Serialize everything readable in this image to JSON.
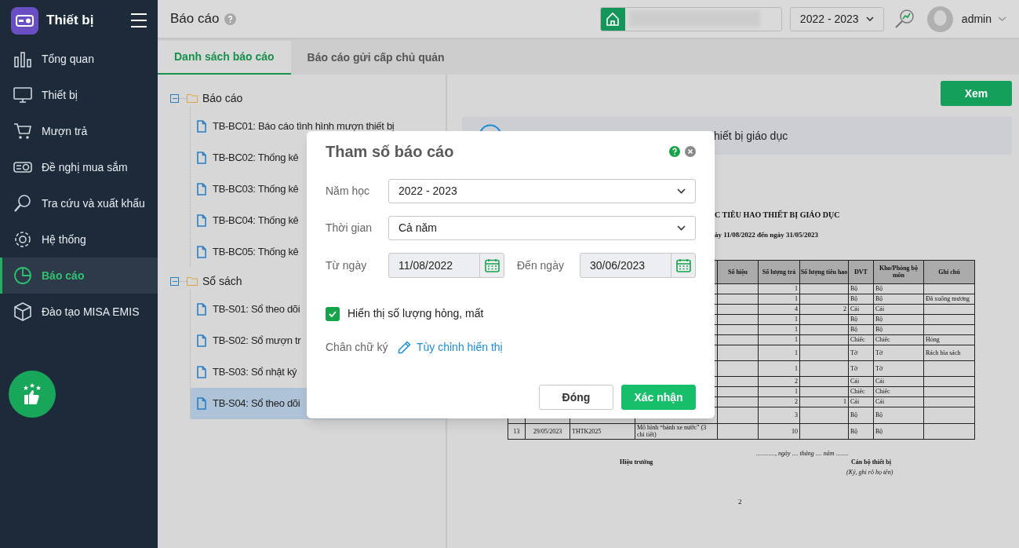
{
  "sidebar": {
    "app_title": "Thiết bị",
    "items": [
      {
        "label": "Tổng quan",
        "selected": false
      },
      {
        "label": "Thiết bị",
        "selected": false
      },
      {
        "label": "Mượn trả",
        "selected": false
      },
      {
        "label": "Đề nghị mua sắm",
        "selected": false
      },
      {
        "label": "Tra cứu và xuất khẩu",
        "selected": false
      },
      {
        "label": "Hệ thống",
        "selected": false
      },
      {
        "label": "Báo cáo",
        "selected": true
      },
      {
        "label": "Đào tạo MISA EMIS",
        "selected": false
      }
    ]
  },
  "header": {
    "title": "Báo cáo",
    "year": "2022 - 2023",
    "user": "admin"
  },
  "tabs": [
    {
      "label": "Danh sách báo cáo",
      "selected": true
    },
    {
      "label": "Báo cáo gửi cấp chủ quản",
      "selected": false
    }
  ],
  "tree": [
    {
      "label": "Báo cáo",
      "expanded": true,
      "children": [
        {
          "label": "TB-BC01: Báo cáo tình hình mượn thiết bị",
          "selected": false
        },
        {
          "label": "TB-BC02: Thống kê",
          "selected": false
        },
        {
          "label": "TB-BC03: Thống kê",
          "selected": false
        },
        {
          "label": "TB-BC04: Thống kê",
          "selected": false
        },
        {
          "label": "TB-BC05: Thống kê",
          "selected": false
        }
      ]
    },
    {
      "label": "Sổ sách",
      "expanded": true,
      "children": [
        {
          "label": "TB-S01: Sổ theo dõi",
          "selected": false
        },
        {
          "label": "TB-S02: Sổ mượn tr",
          "selected": false
        },
        {
          "label": "TB-S03: Sổ nhật ký",
          "selected": false
        },
        {
          "label": "TB-S04: Sổ theo dõi",
          "selected": true
        }
      ]
    }
  ],
  "view_button": "Xem",
  "info_banner": "hiết bị giáo dục",
  "report": {
    "title": "C TIÊU HAO THIẾT BỊ GIÁO DỤC",
    "subtitle": "ày 11/08/2022 đến ngày 31/05/2023",
    "columns": [
      "",
      "",
      "",
      "",
      "Số hiệu",
      "Số lượng trả",
      "Số lượng tiêu hao",
      "ĐVT",
      "Kho/Phòng bộ môn",
      "Ghi chú"
    ],
    "rows": [
      {
        "cells": [
          "",
          "",
          "",
          "",
          "",
          "1",
          "",
          "Bộ",
          "Bộ",
          ""
        ]
      },
      {
        "cells": [
          "",
          "",
          "",
          "",
          "",
          "1",
          "",
          "Bộ",
          "Bộ",
          "Đã xuống mương"
        ]
      },
      {
        "cells": [
          "",
          "",
          "",
          "",
          "",
          "4",
          "2",
          "Cái",
          "Cái",
          ""
        ]
      },
      {
        "cells": [
          "",
          "",
          "",
          "",
          "",
          "1",
          "",
          "Bộ",
          "Bộ",
          ""
        ]
      },
      {
        "cells": [
          "",
          "",
          "",
          "",
          "",
          "1",
          "",
          "Bộ",
          "Bộ",
          ""
        ]
      },
      {
        "cells": [
          "",
          "",
          "",
          "",
          "",
          "1",
          "",
          "Chiếc",
          "Chiếc",
          "Hỏng"
        ]
      },
      {
        "cells": [
          "",
          "",
          "",
          "",
          "",
          "1",
          "",
          "Tờ",
          "Tờ",
          "Rách bìa sách"
        ]
      },
      {
        "cells": [
          "",
          "",
          "",
          "",
          "",
          "1",
          "",
          "Tờ",
          "Tờ",
          ""
        ]
      },
      {
        "cells": [
          "",
          "",
          "",
          "",
          "",
          "2",
          "",
          "Cái",
          "Cái",
          ""
        ]
      },
      {
        "cells": [
          "",
          "",
          "",
          "",
          "",
          "1",
          "",
          "Chiếc",
          "Chiếc",
          ""
        ]
      },
      {
        "cells": [
          "",
          "",
          "",
          "",
          "",
          "2",
          "1",
          "Cái",
          "Cái",
          ""
        ]
      },
      {
        "cells": [
          "",
          "",
          "",
          "",
          "",
          "3",
          "",
          "Bộ",
          "Bộ",
          ""
        ]
      },
      {
        "cells": [
          "13",
          "29/05/2023",
          "THTK2025",
          "Mô hình “bánh xe nước” (3 chi tiết)",
          "",
          "10",
          "",
          "Bộ",
          "Bộ",
          ""
        ]
      }
    ],
    "date_line": "............, ngày .... tháng .... năm ........",
    "left_signer": "Hiệu trưởng",
    "right_signer": "Cán bộ thiết bị",
    "signer_note": "(Ký, ghi rõ họ tên)",
    "page_number": "2"
  },
  "dialog": {
    "title": "Tham số báo cáo",
    "school_year": {
      "label": "Năm học",
      "value": "2022 - 2023"
    },
    "period": {
      "label": "Thời gian",
      "value": "Cả năm"
    },
    "from_date": {
      "label": "Từ ngày",
      "value": "11/08/2022"
    },
    "to_date": {
      "label": "Đến ngày",
      "value": "30/06/2023"
    },
    "show_damaged": {
      "label": "Hiển thị số lượng hỏng, mất",
      "checked": true
    },
    "signature": {
      "label": "Chân chữ ký",
      "link": "Tùy chỉnh hiển thị"
    },
    "buttons": [
      {
        "label": "Đóng",
        "kind": "secondary"
      },
      {
        "label": "Xác nhận",
        "kind": "primary"
      }
    ]
  }
}
